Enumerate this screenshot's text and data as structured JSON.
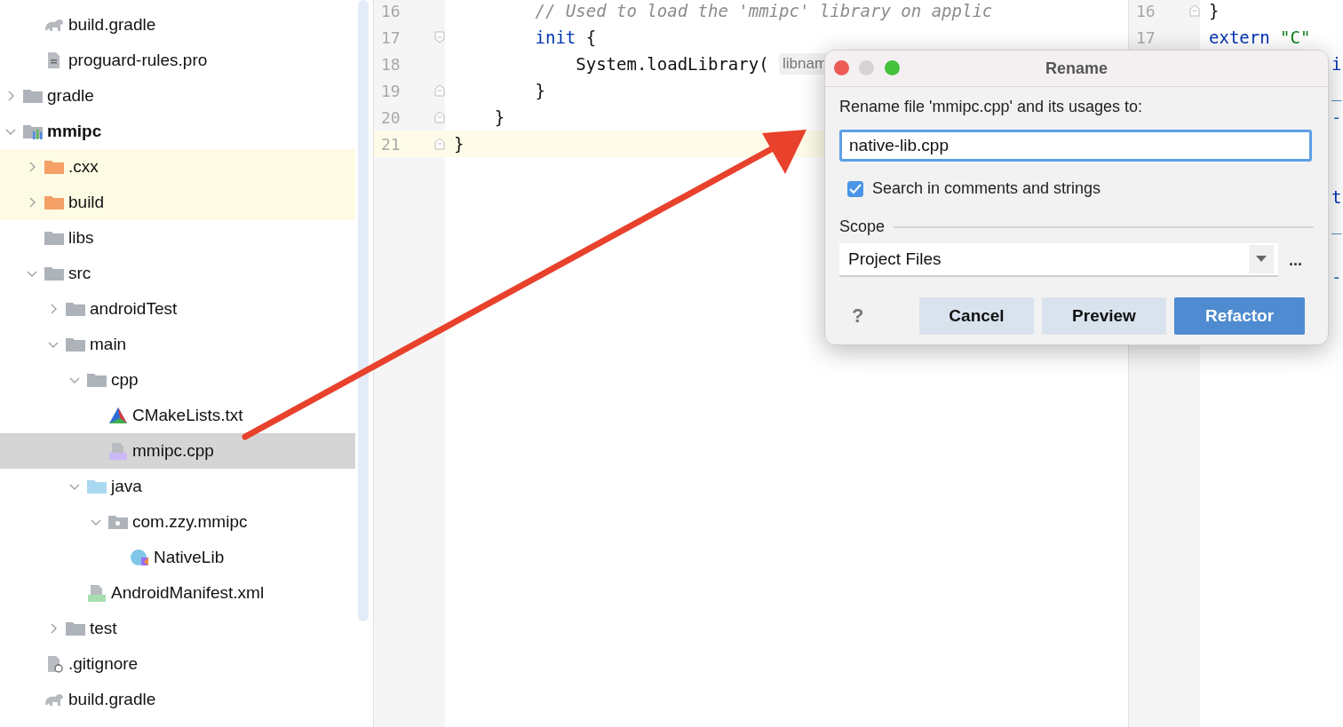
{
  "project_tree": {
    "items": [
      {
        "children": [
          {
            "label": "build.gradle",
            "kind": "gradle",
            "selected": false
          },
          {
            "label": "proguard-rules.pro",
            "kind": "text-file",
            "selected": false
          }
        ]
      },
      {
        "label": "gradle",
        "kind": "folder",
        "expanded": false,
        "selected": false
      },
      {
        "label": "mmipc",
        "kind": "module",
        "expanded": true,
        "selected": false,
        "children": [
          {
            "label": ".cxx",
            "kind": "excluded-folder",
            "expanded": false,
            "selected": false
          },
          {
            "label": "build",
            "kind": "excluded-folder",
            "expanded": false,
            "selected": false
          },
          {
            "label": "libs",
            "kind": "folder",
            "selected": false
          },
          {
            "label": "src",
            "kind": "folder",
            "expanded": true,
            "selected": false,
            "children": [
              {
                "label": "androidTest",
                "kind": "folder",
                "expanded": false,
                "selected": false
              },
              {
                "label": "main",
                "kind": "folder",
                "expanded": true,
                "selected": false,
                "children": [
                  {
                    "label": "cpp",
                    "kind": "folder",
                    "expanded": true,
                    "selected": false,
                    "children": [
                      {
                        "label": "CMakeLists.txt",
                        "kind": "cmake",
                        "selected": false
                      },
                      {
                        "label": "mmipc.cpp",
                        "kind": "cpp-file",
                        "selected": true
                      }
                    ]
                  },
                  {
                    "label": "java",
                    "kind": "source-folder",
                    "expanded": true,
                    "selected": false,
                    "children": [
                      {
                        "label": "com.zzy.mmipc",
                        "kind": "package",
                        "expanded": true,
                        "selected": false,
                        "children": [
                          {
                            "label": "NativeLib",
                            "kind": "kotlin-class",
                            "selected": false
                          }
                        ]
                      }
                    ]
                  },
                  {
                    "label": "AndroidManifest.xml",
                    "kind": "manifest",
                    "selected": false
                  }
                ]
              },
              {
                "label": "test",
                "kind": "folder",
                "expanded": false,
                "selected": false
              }
            ]
          },
          {
            "label": ".gitignore",
            "kind": "gitignore",
            "selected": false
          },
          {
            "label": "build.gradle",
            "kind": "gradle",
            "selected": false
          }
        ]
      }
    ]
  },
  "left_editor": {
    "lines": [
      {
        "number": "16",
        "current": false,
        "tokens": [
          {
            "kind": "comment",
            "text": "        // Used to load the 'mmipc' library on applic"
          }
        ]
      },
      {
        "number": "17",
        "current": false,
        "fold_start": true,
        "tokens": [
          {
            "kind": "keyword",
            "text": "        init"
          },
          {
            "kind": "plain",
            "text": " {"
          }
        ]
      },
      {
        "number": "18",
        "current": false,
        "tokens": [
          {
            "kind": "plain",
            "text": "            System.loadLibrary( "
          },
          {
            "kind": "hint",
            "text": "libnam"
          }
        ]
      },
      {
        "number": "19",
        "current": false,
        "fold_end": true,
        "tokens": [
          {
            "kind": "plain",
            "text": "        }"
          }
        ]
      },
      {
        "number": "20",
        "current": false,
        "fold_end": true,
        "tokens": [
          {
            "kind": "plain",
            "text": "    }"
          }
        ]
      },
      {
        "number": "21",
        "current": true,
        "fold_end": true,
        "tokens": [
          {
            "kind": "plain",
            "text": "}"
          }
        ]
      }
    ]
  },
  "right_editor": {
    "lines": [
      {
        "number": "16",
        "fold_end": true,
        "tokens": [
          {
            "kind": "plain",
            "text": "}"
          }
        ]
      },
      {
        "number": "17",
        "tokens": [
          {
            "kind": "keyword",
            "text": "extern "
          },
          {
            "kind": "string",
            "text": "\"C\""
          }
        ]
      },
      {
        "tail": {
          "kind": "keyword",
          "text": "i"
        }
      },
      {
        "tail": {
          "kind": "param",
          "text": "_"
        }
      },
      {
        "tail": {
          "kind": "param",
          "text": "-"
        }
      },
      {
        "blank": true
      },
      {
        "blank": true
      },
      {
        "tail": {
          "kind": "keyword",
          "text": "t"
        }
      },
      {
        "tail": {
          "kind": "param",
          "text": "_"
        }
      },
      {
        "blank": true
      },
      {
        "tail": {
          "kind": "param",
          "text": "-"
        }
      }
    ]
  },
  "dialog": {
    "title": "Rename",
    "prompt": "Rename file 'mmipc.cpp' and its usages to:",
    "new_name": "native-lib.cpp",
    "search_option": {
      "label": "Search in comments and strings",
      "checked": true
    },
    "scope_label": "Scope",
    "scope_value": "Project Files",
    "more": "...",
    "help": "?",
    "buttons": [
      {
        "label": "Cancel",
        "primary": false
      },
      {
        "label": "Preview",
        "primary": false
      },
      {
        "label": "Refactor",
        "primary": true
      }
    ]
  }
}
